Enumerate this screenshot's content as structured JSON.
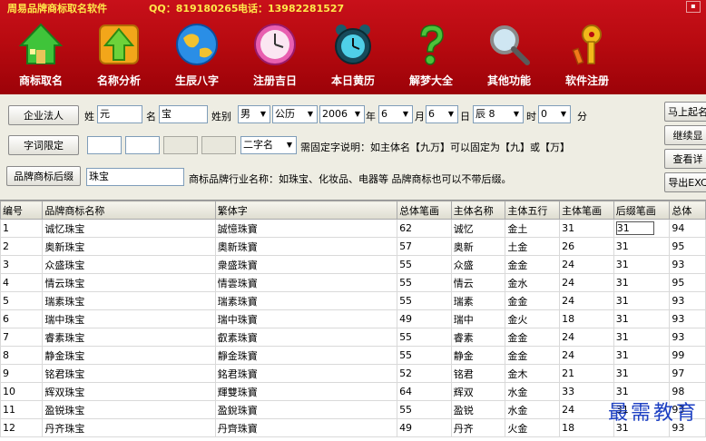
{
  "titlebar": {
    "app_name": "周易品牌商标取名软件",
    "qq": "QQ：819180265",
    "phone": "电话：13982281527",
    "minimize": "▪"
  },
  "toolbar": [
    {
      "label": "商标取名",
      "icon": "house-icon"
    },
    {
      "label": "名称分析",
      "icon": "up-arrow-icon"
    },
    {
      "label": "生辰八字",
      "icon": "globe-icon"
    },
    {
      "label": "注册吉日",
      "icon": "clock-icon"
    },
    {
      "label": "本日黄历",
      "icon": "alarm-clock-icon"
    },
    {
      "label": "解梦大全",
      "icon": "question-icon"
    },
    {
      "label": "其他功能",
      "icon": "magnifier-icon"
    },
    {
      "label": "软件注册",
      "icon": "keys-icon"
    }
  ],
  "form": {
    "row1": {
      "type_button": "企业法人",
      "surname_label": "姓",
      "surname_value": "元",
      "name_label": "名",
      "name_value": "宝",
      "gender_label": "姓别",
      "gender_value": "男",
      "calendar_value": "公历",
      "year_value": "2006",
      "year_label": "年",
      "month_value": "6",
      "month_label": "月",
      "day_value": "6",
      "day_label": "日",
      "hour_branch_value": "辰 8",
      "hour_label": "时",
      "minute_value": "0",
      "minute_label": "分"
    },
    "row2": {
      "limit_button": "字词限定",
      "chars_value": "二字名",
      "hint": "需固定字说明：如主体名【九万】可以固定为【九】或【万】"
    },
    "row3": {
      "suffix_button": "品牌商标后缀",
      "suffix_value": "珠宝",
      "hint": "商标品牌行业名称：如珠宝、化妆品、电器等 品牌商标也可以不带后缀。"
    },
    "side_buttons": [
      "马上起名",
      "继续显",
      "查看详",
      "导出EXC"
    ]
  },
  "table": {
    "headers": [
      "编号",
      "品牌商标名称",
      "繁体字",
      "总体笔画",
      "主体名称",
      "主体五行",
      "主体笔画",
      "后缀笔画",
      "总体"
    ],
    "rows": [
      [
        "1",
        "诚忆珠宝",
        "誠憶珠寶",
        "62",
        "诚忆",
        "金土",
        "31",
        "31",
        "94"
      ],
      [
        "2",
        "奥新珠宝",
        "奧新珠寶",
        "57",
        "奥新",
        "土金",
        "26",
        "31",
        "95"
      ],
      [
        "3",
        "众盛珠宝",
        "衆盛珠寶",
        "55",
        "众盛",
        "金金",
        "24",
        "31",
        "93"
      ],
      [
        "4",
        "情云珠宝",
        "情雲珠寶",
        "55",
        "情云",
        "金水",
        "24",
        "31",
        "95"
      ],
      [
        "5",
        "瑞素珠宝",
        "瑞素珠寶",
        "55",
        "瑞素",
        "金金",
        "24",
        "31",
        "93"
      ],
      [
        "6",
        "瑞中珠宝",
        "瑞中珠寶",
        "49",
        "瑞中",
        "金火",
        "18",
        "31",
        "93"
      ],
      [
        "7",
        "睿素珠宝",
        "叡素珠寶",
        "55",
        "睿素",
        "金金",
        "24",
        "31",
        "93"
      ],
      [
        "8",
        "静金珠宝",
        "靜金珠寶",
        "55",
        "静金",
        "金金",
        "24",
        "31",
        "99"
      ],
      [
        "9",
        "铭君珠宝",
        "銘君珠寶",
        "52",
        "铭君",
        "金木",
        "21",
        "31",
        "97"
      ],
      [
        "10",
        "辉双珠宝",
        "輝雙珠寶",
        "64",
        "辉双",
        "水金",
        "33",
        "31",
        "98"
      ],
      [
        "11",
        "盈锐珠宝",
        "盈銳珠寶",
        "55",
        "盈锐",
        "水金",
        "24",
        "31",
        "93"
      ],
      [
        "12",
        "丹齐珠宝",
        "丹齊珠寶",
        "49",
        "丹齐",
        "火金",
        "18",
        "31",
        "93"
      ]
    ]
  },
  "watermark": "最需教育",
  "colors": {
    "header_red": "#b80a10",
    "title_yellow": "#ffe84a",
    "watermark_blue": "#1c3fc2"
  }
}
